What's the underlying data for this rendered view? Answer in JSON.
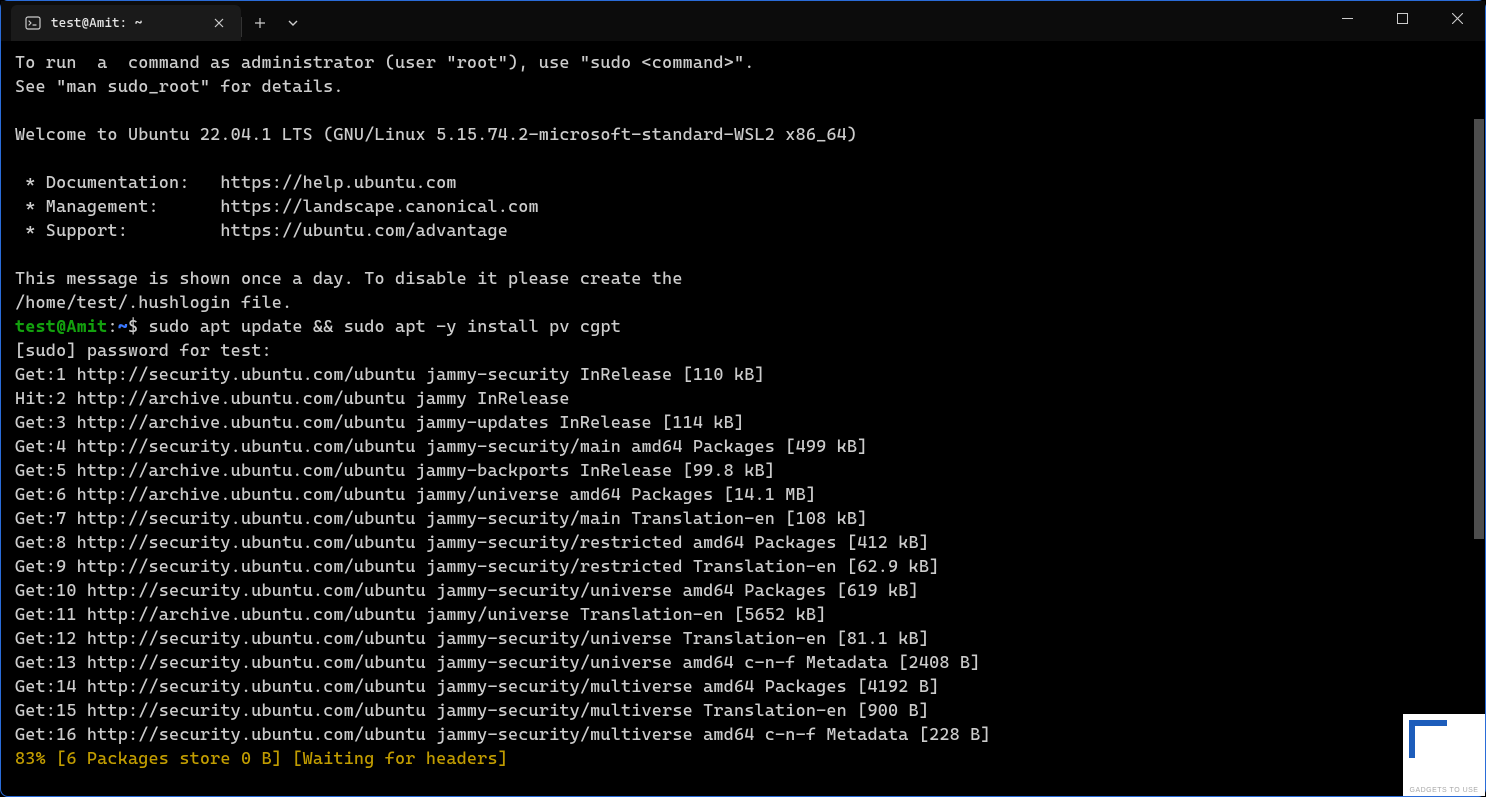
{
  "titlebar": {
    "tab_label": "test@Amit: ~"
  },
  "colors": {
    "prompt_user": "#13a10e",
    "prompt_path": "#3b78ff",
    "progress": "#c19c00"
  },
  "terminal": {
    "motd": [
      "To run  a  command as administrator (user \"root\"), use \"sudo <command>\".",
      "See \"man sudo_root\" for details.",
      "",
      "Welcome to Ubuntu 22.04.1 LTS (GNU/Linux 5.15.74.2-microsoft-standard-WSL2 x86_64)",
      "",
      " * Documentation:   https://help.ubuntu.com",
      " * Management:      https://landscape.canonical.com",
      " * Support:         https://ubuntu.com/advantage",
      "",
      "This message is shown once a day. To disable it please create the",
      "/home/test/.hushlogin file."
    ],
    "prompt": {
      "user_host": "test@Amit",
      "sep": ":",
      "path": "~",
      "dollar": "$ ",
      "command": "sudo apt update && sudo apt -y install pv cgpt"
    },
    "output": [
      "[sudo] password for test:",
      "Get:1 http://security.ubuntu.com/ubuntu jammy-security InRelease [110 kB]",
      "Hit:2 http://archive.ubuntu.com/ubuntu jammy InRelease",
      "Get:3 http://archive.ubuntu.com/ubuntu jammy-updates InRelease [114 kB]",
      "Get:4 http://security.ubuntu.com/ubuntu jammy-security/main amd64 Packages [499 kB]",
      "Get:5 http://archive.ubuntu.com/ubuntu jammy-backports InRelease [99.8 kB]",
      "Get:6 http://archive.ubuntu.com/ubuntu jammy/universe amd64 Packages [14.1 MB]",
      "Get:7 http://security.ubuntu.com/ubuntu jammy-security/main Translation-en [108 kB]",
      "Get:8 http://security.ubuntu.com/ubuntu jammy-security/restricted amd64 Packages [412 kB]",
      "Get:9 http://security.ubuntu.com/ubuntu jammy-security/restricted Translation-en [62.9 kB]",
      "Get:10 http://security.ubuntu.com/ubuntu jammy-security/universe amd64 Packages [619 kB]",
      "Get:11 http://archive.ubuntu.com/ubuntu jammy/universe Translation-en [5652 kB]",
      "Get:12 http://security.ubuntu.com/ubuntu jammy-security/universe Translation-en [81.1 kB]",
      "Get:13 http://security.ubuntu.com/ubuntu jammy-security/universe amd64 c-n-f Metadata [2408 B]",
      "Get:14 http://security.ubuntu.com/ubuntu jammy-security/multiverse amd64 Packages [4192 B]",
      "Get:15 http://security.ubuntu.com/ubuntu jammy-security/multiverse Translation-en [900 B]",
      "Get:16 http://security.ubuntu.com/ubuntu jammy-security/multiverse amd64 c-n-f Metadata [228 B]"
    ],
    "progress": "83% [6 Packages store 0 B] [Waiting for headers]"
  },
  "watermark": "GADGETS TO USE"
}
